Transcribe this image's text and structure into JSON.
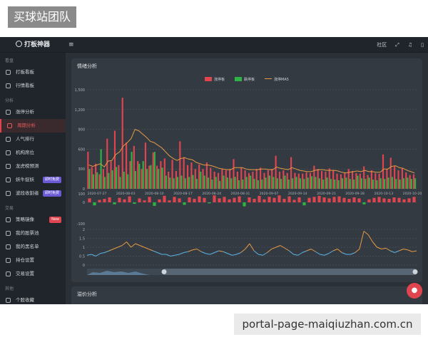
{
  "banner": {
    "title": "买球站团队"
  },
  "watermark": {
    "text": "portal-page-maiqiuzhan.com.cn"
  },
  "header": {
    "logo": "打板神器",
    "menu_icon": "hamburger-icon",
    "community_label": "社区",
    "expand_icon": "expand-icon",
    "bell_icon": "bell-icon",
    "more_icon": "more-icon"
  },
  "sidebar": {
    "groups": [
      {
        "label": "看盘",
        "items": [
          {
            "label": "打板看板",
            "icon": "gauge-icon"
          },
          {
            "label": "行情看板",
            "icon": "grid-icon"
          }
        ]
      },
      {
        "label": "分析",
        "items": [
          {
            "label": "涨停分析",
            "icon": "trend-icon"
          },
          {
            "label": "周期分析",
            "icon": "cycle-icon",
            "active": true
          },
          {
            "label": "人气排行",
            "icon": "fire-icon"
          },
          {
            "label": "机构席位",
            "icon": "bank-icon"
          },
          {
            "label": "龙虎榜预测",
            "icon": "dragon-icon"
          },
          {
            "label": "妖牛捉妖",
            "icon": "pin-icon",
            "tag": "即时免费",
            "tag_color": "purple"
          },
          {
            "label": "波段收割者",
            "icon": "wave-icon",
            "tag": "即时免费",
            "tag_color": "purple"
          }
        ]
      },
      {
        "label": "交易",
        "items": [
          {
            "label": "策略镜像",
            "icon": "doc-icon",
            "tag": "New",
            "tag_color": "red"
          },
          {
            "label": "我的股票池",
            "icon": "list-icon"
          },
          {
            "label": "我的黑名单",
            "icon": "block-icon"
          },
          {
            "label": "持仓设置",
            "icon": "position-icon"
          },
          {
            "label": "交易设置",
            "icon": "settings-icon"
          }
        ]
      },
      {
        "label": "其他",
        "items": [
          {
            "label": "个股收藏",
            "icon": "star-icon"
          }
        ]
      }
    ]
  },
  "panel": {
    "title": "情绪分析"
  },
  "panel2": {
    "title": "溢价分析"
  },
  "chart_data": {
    "type": "bar",
    "legend": [
      "涨停板",
      "跌停板",
      "涨停MA5"
    ],
    "colors": {
      "up": "#e0454f",
      "down": "#2fb344",
      "ma": "#e79a44",
      "line": "#5bb6e6"
    },
    "ylim": [
      0,
      1500
    ],
    "yticks": [
      "1,500",
      "1,200",
      "900",
      "600",
      "300",
      "0"
    ],
    "x_labels": [
      "2020-07-27",
      "2020-08-03",
      "2020-08-10",
      "2020-08-17",
      "2020-08-24",
      "2020-08-31",
      "2020-09-07",
      "2020-09-14",
      "2020-09-21",
      "2020-09-28",
      "2020-10-13",
      "2020-10-20"
    ],
    "red": [
      560,
      330,
      380,
      220,
      300,
      760,
      420,
      880,
      360,
      1380,
      700,
      420,
      650,
      420,
      300,
      700,
      350,
      550,
      350,
      420,
      460,
      260,
      440,
      270,
      720,
      480,
      360,
      400,
      300,
      370,
      300,
      400,
      320,
      260,
      240,
      300,
      280,
      300,
      450,
      260,
      320,
      280,
      240,
      260,
      300,
      320,
      240,
      280,
      300,
      500,
      260,
      280,
      240,
      480,
      240,
      230,
      230,
      250,
      240,
      350,
      300,
      270,
      260,
      310,
      280,
      230,
      220,
      250,
      300,
      270,
      240,
      230,
      340,
      210,
      280,
      240,
      230,
      520,
      300,
      470,
      350,
      280,
      320,
      250,
      210,
      220
    ],
    "green": [
      300,
      220,
      250,
      600,
      180,
      240,
      280,
      330,
      180,
      260,
      220,
      560,
      270,
      380,
      420,
      300,
      360,
      560,
      300,
      320,
      200,
      170,
      160,
      180,
      200,
      160,
      180,
      210,
      150,
      260,
      200,
      170,
      140,
      180,
      120,
      200,
      170,
      160,
      180,
      130,
      140,
      180,
      200,
      150,
      130,
      140,
      170,
      200,
      180,
      160,
      150,
      200,
      140,
      160,
      180,
      160,
      150,
      170,
      190,
      180,
      160,
      140,
      170,
      150,
      140,
      130,
      160,
      170,
      150,
      140,
      200,
      160,
      150,
      170,
      140,
      130,
      160,
      150,
      170,
      180,
      150,
      140,
      160,
      170,
      150,
      160
    ],
    "ma5": [
      360,
      340,
      360,
      380,
      330,
      420,
      430,
      520,
      560,
      650,
      700,
      760,
      900,
      880,
      830,
      780,
      720,
      700,
      660,
      620,
      560,
      500,
      460,
      430,
      460,
      470,
      450,
      440,
      400,
      380,
      360,
      360,
      350,
      330,
      310,
      300,
      290,
      290,
      320,
      320,
      320,
      300,
      290,
      290,
      290,
      300,
      300,
      290,
      290,
      330,
      310,
      300,
      290,
      320,
      300,
      280,
      270,
      260,
      260,
      280,
      290,
      290,
      280,
      280,
      280,
      270,
      250,
      240,
      250,
      260,
      270,
      260,
      280,
      260,
      260,
      250,
      250,
      300,
      300,
      340,
      350,
      320,
      310,
      280,
      260,
      240
    ],
    "sub_ticks": [
      "100",
      "0",
      "-100"
    ],
    "sub_values": [
      40,
      -30,
      25,
      35,
      50,
      -20,
      45,
      30,
      60,
      -15,
      40,
      20,
      55,
      -35,
      30,
      65,
      20,
      55,
      40,
      -25,
      50,
      35,
      60,
      45,
      -10,
      70,
      40,
      55,
      30,
      45,
      60,
      -40,
      50,
      35,
      65,
      30,
      55,
      45,
      70,
      35,
      60,
      25,
      50,
      -30,
      45,
      55,
      65,
      50,
      40,
      55,
      60,
      45,
      35,
      50,
      40,
      -20,
      30,
      45,
      55,
      40,
      35,
      50,
      45,
      30,
      40,
      55
    ],
    "ratio_ticks": [
      "2",
      "1.5",
      "1",
      "0.5",
      "0"
    ],
    "ratio_values": [
      0.55,
      0.6,
      0.5,
      0.65,
      0.7,
      0.8,
      0.9,
      1.0,
      1.1,
      1.3,
      1.0,
      1.2,
      1.1,
      1.0,
      0.9,
      0.8,
      0.7,
      0.6,
      0.6,
      0.5,
      0.55,
      0.6,
      0.7,
      0.75,
      0.85,
      0.9,
      0.75,
      0.65,
      0.6,
      0.7,
      0.8,
      0.75,
      0.65,
      0.55,
      0.6,
      0.7,
      0.9,
      1.2,
      0.8,
      0.6,
      0.55,
      0.7,
      0.9,
      1.0,
      1.1,
      0.95,
      0.8,
      0.6,
      0.55,
      0.7,
      0.8,
      0.9,
      0.75,
      0.6,
      0.55,
      0.65,
      0.8,
      0.9,
      0.7,
      0.6,
      0.6,
      0.7,
      0.9,
      1.9,
      1.7,
      1.3,
      1.0,
      0.9,
      0.95,
      0.8,
      0.7,
      0.8,
      0.9,
      0.85,
      0.75,
      0.8
    ]
  }
}
